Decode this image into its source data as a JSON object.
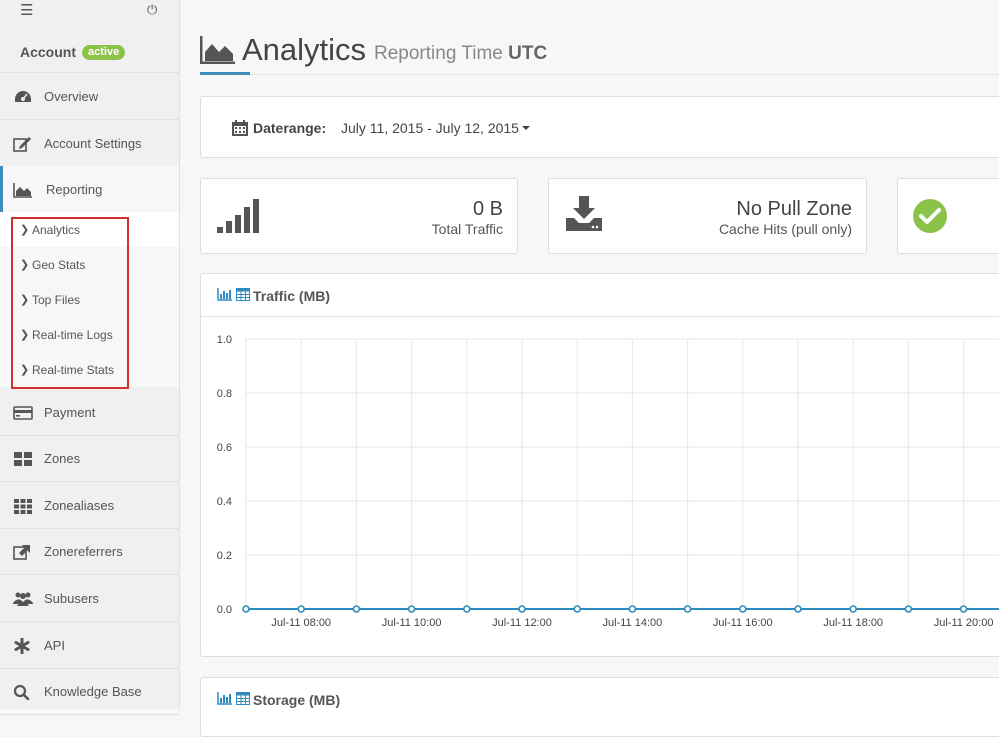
{
  "sidebar": {
    "account_label": "Account",
    "account_badge": "active",
    "items": [
      {
        "label": "Overview"
      },
      {
        "label": "Account Settings"
      },
      {
        "label": "Reporting"
      },
      {
        "label": "Payment"
      },
      {
        "label": "Zones"
      },
      {
        "label": "Zonealiases"
      },
      {
        "label": "Zonereferrers"
      },
      {
        "label": "Subusers"
      },
      {
        "label": "API"
      },
      {
        "label": "Knowledge Base"
      }
    ],
    "reporting_sub": [
      {
        "label": "Analytics"
      },
      {
        "label": "Geo Stats"
      },
      {
        "label": "Top Files"
      },
      {
        "label": "Real-time Logs"
      },
      {
        "label": "Real-time Stats"
      }
    ]
  },
  "header": {
    "title": "Analytics",
    "subtitle_prefix": "Reporting Time",
    "subtitle_tz": "UTC"
  },
  "daterange": {
    "label": "Daterange:",
    "value": "July 11, 2015 - July 12, 2015"
  },
  "stats": [
    {
      "value": "0 B",
      "label": "Total Traffic",
      "icon": "signal-bars-icon"
    },
    {
      "value": "No Pull Zone",
      "label": "Cache Hits (pull only)",
      "icon": "download-icon"
    },
    {
      "value": "",
      "label": "",
      "icon": "check-circle-icon"
    }
  ],
  "colors": {
    "accent": "#3c8dbc",
    "active_badge": "#8bc34a",
    "check": "#8bc34a",
    "highlight_box": "#d32f2f",
    "series": "#2e8bc0"
  },
  "traffic_panel": {
    "title": "Traffic (MB)"
  },
  "storage_panel": {
    "title": "Storage (MB)"
  },
  "chart_data": {
    "type": "line",
    "title": "Traffic (MB)",
    "xlabel": "",
    "ylabel": "",
    "ylim": [
      0,
      1.0
    ],
    "y_ticks": [
      "0.0",
      "0.2",
      "0.4",
      "0.6",
      "0.8",
      "1.0"
    ],
    "x_ticks": [
      "Jul-11 08:00",
      "Jul-11 10:00",
      "Jul-11 12:00",
      "Jul-11 14:00",
      "Jul-11 16:00",
      "Jul-11 18:00",
      "Jul-11 20:00"
    ],
    "grid": true,
    "series": [
      {
        "x": [
          "Jul-11 07:00",
          "Jul-11 08:00",
          "Jul-11 09:00",
          "Jul-11 10:00",
          "Jul-11 11:00",
          "Jul-11 12:00",
          "Jul-11 13:00",
          "Jul-11 14:00",
          "Jul-11 15:00",
          "Jul-11 16:00",
          "Jul-11 17:00",
          "Jul-11 18:00",
          "Jul-11 19:00",
          "Jul-11 20:00"
        ],
        "values": [
          0,
          0,
          0,
          0,
          0,
          0,
          0,
          0,
          0,
          0,
          0,
          0,
          0,
          0
        ]
      }
    ]
  }
}
